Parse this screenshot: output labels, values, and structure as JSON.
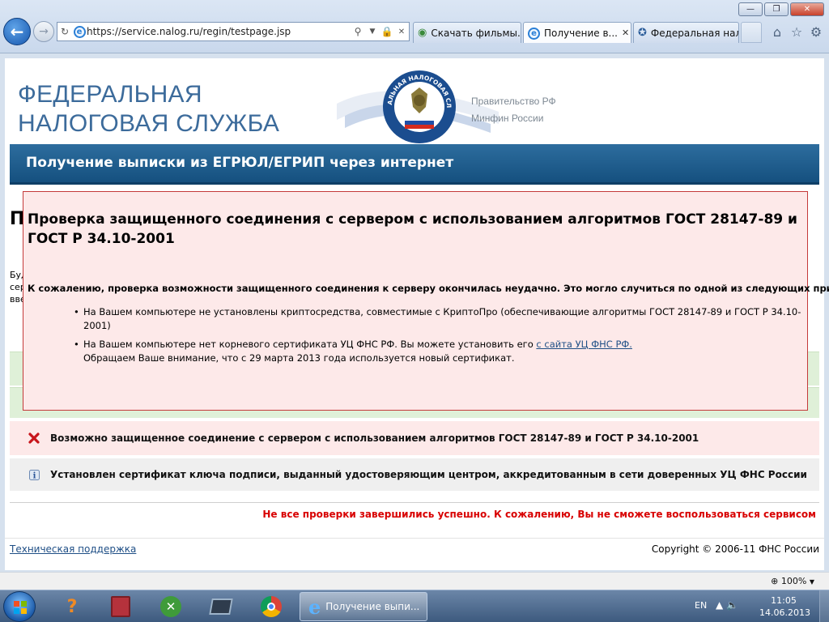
{
  "browser": {
    "url": "https://service.nalog.ru/regin/testpage.jsp",
    "tabs": [
      {
        "label": "Скачать фильмы..."
      },
      {
        "label": "Получение в..."
      },
      {
        "label": "Федеральная нал..."
      }
    ],
    "zoom": "100%"
  },
  "header": {
    "logo_line1": "ФЕДЕРАЛЬНАЯ",
    "logo_line2": "НАЛОГОВАЯ СЛУЖБА",
    "gov_link1": "Правительство РФ",
    "gov_link2": "Минфин России",
    "banner": "Получение выписки из ЕГРЮЛ/ЕГРИП через интернет",
    "emblem_text": "ФЕДЕРАЛЬНАЯ НАЛОГОВАЯ СЛУЖБА"
  },
  "background": {
    "heading_fragment": "П",
    "text_line1": "Буд",
    "text_line2": "сер",
    "text_line3": "вве"
  },
  "dialog": {
    "title": "Проверка защищенного соединения с сервером с использованием алгоритмов ГОСТ 28147-89 и ГОСТ Р 34.10-2001",
    "intro": "К сожалению, проверка возможности защищенного соединения к серверу окончилась неудачно. Это могло случиться по одной из следующих причин:",
    "reason1": "На Вашем компьютере не установлены криптосредства, совместимые с КриптоПро (обеспечивающие алгоритмы ГОСТ 28147-89 и ГОСТ Р 34.10-2001)",
    "reason2_prefix": "На Вашем компьютере нет корневого сертификата УЦ ФНС РФ. Вы можете установить его",
    "reason2_link": "с сайта УЦ ФНС РФ.",
    "reason2_note": "Обращаем Ваше внимание, что с 29 марта 2013 года используется новый сертификат."
  },
  "checks": {
    "error_row": "Возможно защищенное соединение с сервером с использованием алгоритмов ГОСТ 28147-89 и ГОСТ Р 34.10-2001",
    "info_row": "Установлен сертификат ключа подписи, выданный удостоверяющим центром, аккредитованным в сети доверенных УЦ ФНС России",
    "final_status": "Не все проверки завершились успешно. К сожалению, Вы не сможете воспользоваться сервисом"
  },
  "footer": {
    "support_link": "Техническая поддержка",
    "copyright": "Copyright © 2006-11 ФНС России"
  },
  "taskbar": {
    "active_window": "Получение выпи...",
    "lang": "EN",
    "time": "11:05",
    "date": "14.06.2013"
  },
  "colors": {
    "banner": "#1f5f90",
    "error_bg": "#fde9e9",
    "error_border": "#c43a3a",
    "status_red": "#d80000",
    "success_bg": "#dff0d8",
    "logo_blue": "#3c6b9b"
  }
}
